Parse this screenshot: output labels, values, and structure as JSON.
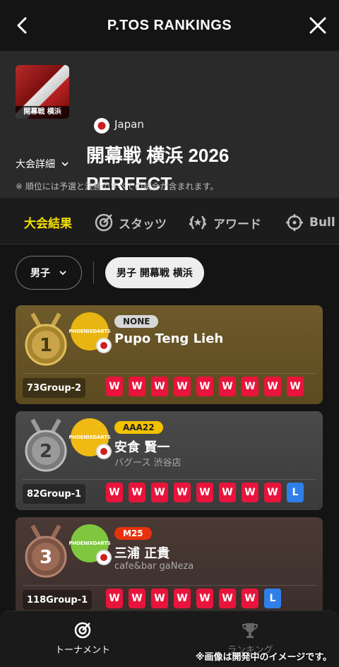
{
  "topbar": {
    "title": "P.TOS RANKINGS",
    "back_icon": "chevron-left-icon",
    "close_icon": "close-icon"
  },
  "event": {
    "thumb_caption": "開幕戦 横浜",
    "country": "Japan",
    "title_line1": "開幕戦 横浜 2026",
    "title_line2": "PERFECT",
    "details_label": "大会詳細",
    "note": "※ 順位には予選と決勝のすべての試合が含まれます。"
  },
  "tabs": [
    {
      "label": "大会結果",
      "icon": ""
    },
    {
      "label": "スタッツ",
      "icon": "target-icon"
    },
    {
      "label": "アワード",
      "icon": "laurel-icon"
    },
    {
      "label": "Bull",
      "icon": "crosshair-icon"
    }
  ],
  "filters": {
    "gender": "男子",
    "selected": "男子 開幕戦 横浜"
  },
  "colors": {
    "accent": "#f5e100",
    "win": "#e8143c",
    "loss": "#2f7fe8"
  },
  "players": [
    {
      "rank": "1",
      "logo_text": "PHOENIXDARTS",
      "badge": "NONE",
      "badge_bg": "#d8d8d8",
      "badge_fg": "#222222",
      "name": "Pupo Teng Lieh",
      "shop": "",
      "group": "73Group-2",
      "results": [
        "W",
        "W",
        "W",
        "W",
        "W",
        "W",
        "W",
        "W",
        "W"
      ]
    },
    {
      "rank": "2",
      "logo_text": "PHOENIXDARTS",
      "badge": "AAA22",
      "badge_bg": "#f2c200",
      "badge_fg": "#222222",
      "name": "安食 賢一",
      "shop": "バグース 渋谷店",
      "group": "82Group-1",
      "results": [
        "W",
        "W",
        "W",
        "W",
        "W",
        "W",
        "W",
        "W",
        "L"
      ]
    },
    {
      "rank": "3",
      "logo_text": "PHOENIXDARTS",
      "badge": "M25",
      "badge_bg": "#e8320e",
      "badge_fg": "#ffffff",
      "name": "三浦 正貴",
      "shop": "cafe&bar gaNeza",
      "group": "118Group-1",
      "results": [
        "W",
        "W",
        "W",
        "W",
        "W",
        "W",
        "W",
        "L"
      ]
    }
  ],
  "bottom_nav": {
    "tournament": "トーナメント",
    "ranking": "ランキング"
  },
  "watermark": "※画像は開発中のイメージです。"
}
